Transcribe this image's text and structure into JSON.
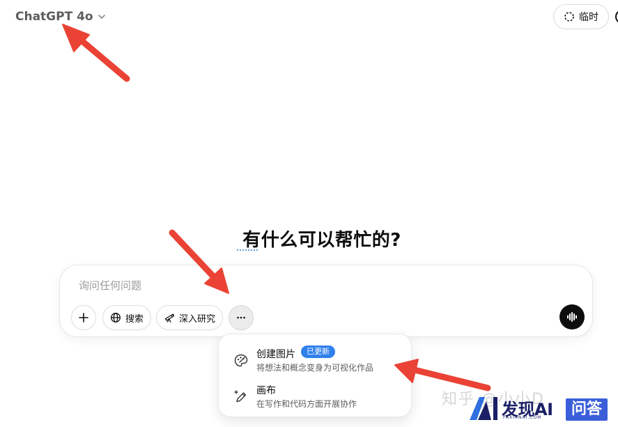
{
  "header": {
    "model_name": "ChatGPT 4o",
    "temporary_label": "临时"
  },
  "main": {
    "headline": "有什么可以帮忙的?"
  },
  "composer": {
    "placeholder": "询问任何问题",
    "tools": {
      "search_label": "搜索",
      "deep_research_label": "深入研究"
    }
  },
  "tools_menu": {
    "items": [
      {
        "title": "创建图片",
        "badge": "已更新",
        "description": "将想法和概念变身为可视化作品",
        "icon": "palette-icon"
      },
      {
        "title": "画布",
        "description": "在写作和代码方面开展协作",
        "icon": "pen-sparkle-icon"
      }
    ]
  },
  "overlay": {
    "watermark": "知乎 @小小D",
    "brand_name": "发现AI",
    "brand_domain": "FAXIANAI.COM",
    "qa_label": "问答"
  },
  "colors": {
    "accent_badge": "#2f80ed",
    "annotation_arrow": "#ea4335",
    "brand_navy": "#1a1f66",
    "qa_blue": "#3a5fd9"
  }
}
